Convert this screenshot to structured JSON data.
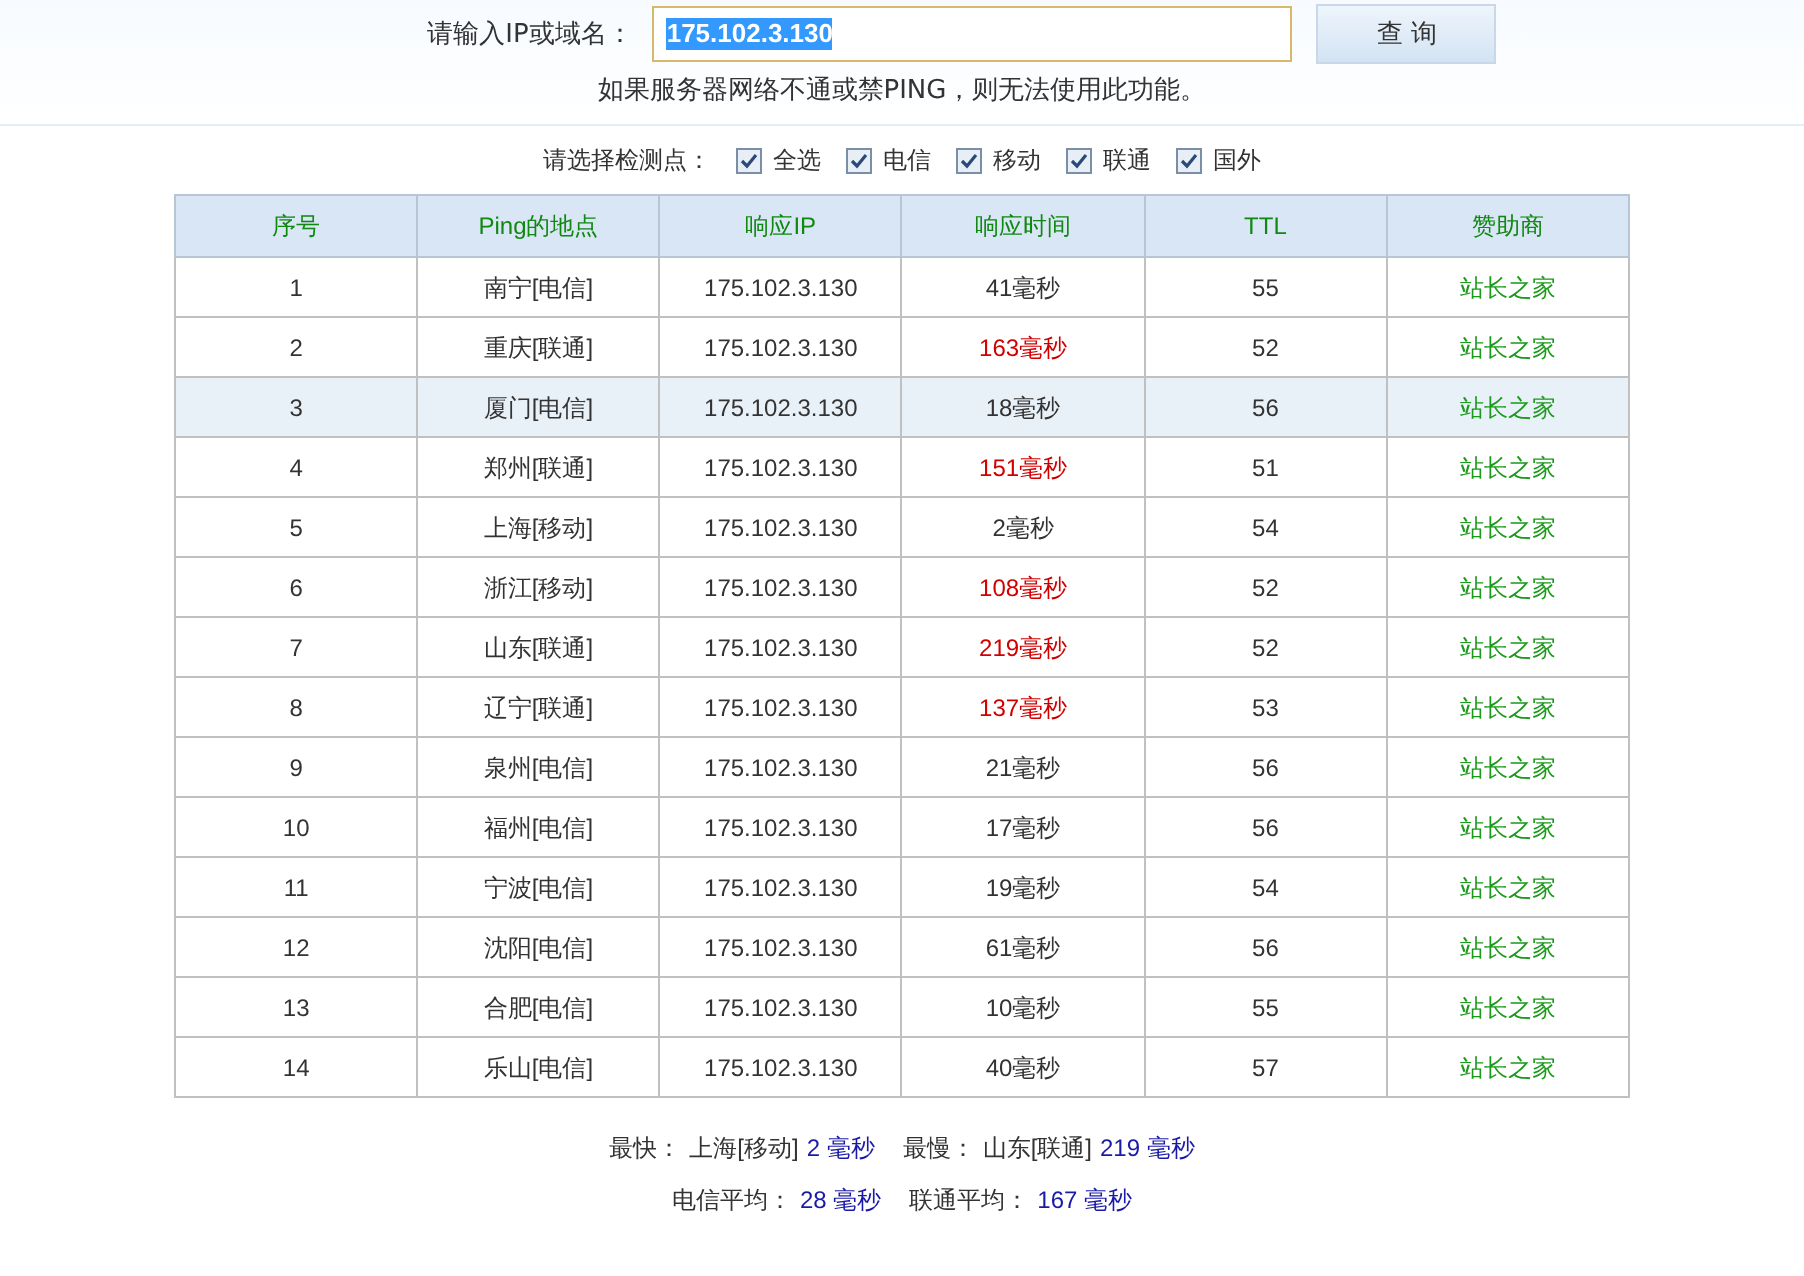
{
  "query": {
    "label": "请输入IP或域名：",
    "value": "175.102.3.130",
    "button": "查 询",
    "note": "如果服务器网络不通或禁PING，则无法使用此功能。"
  },
  "filters": {
    "label": "请选择检测点：",
    "options": [
      {
        "label": "全选",
        "checked": true
      },
      {
        "label": "电信",
        "checked": true
      },
      {
        "label": "移动",
        "checked": true
      },
      {
        "label": "联通",
        "checked": true
      },
      {
        "label": "国外",
        "checked": true
      }
    ]
  },
  "table": {
    "columns": [
      "序号",
      "Ping的地点",
      "响应IP",
      "响应时间",
      "TTL",
      "赞助商"
    ],
    "rows": [
      {
        "no": "1",
        "location": "南宁[电信]",
        "ip": "175.102.3.130",
        "time": "41毫秒",
        "slow": false,
        "ttl": "55",
        "sponsor": "站长之家",
        "selected": false
      },
      {
        "no": "2",
        "location": "重庆[联通]",
        "ip": "175.102.3.130",
        "time": "163毫秒",
        "slow": true,
        "ttl": "52",
        "sponsor": "站长之家",
        "selected": false
      },
      {
        "no": "3",
        "location": "厦门[电信]",
        "ip": "175.102.3.130",
        "time": "18毫秒",
        "slow": false,
        "ttl": "56",
        "sponsor": "站长之家",
        "selected": true
      },
      {
        "no": "4",
        "location": "郑州[联通]",
        "ip": "175.102.3.130",
        "time": "151毫秒",
        "slow": true,
        "ttl": "51",
        "sponsor": "站长之家",
        "selected": false
      },
      {
        "no": "5",
        "location": "上海[移动]",
        "ip": "175.102.3.130",
        "time": "2毫秒",
        "slow": false,
        "ttl": "54",
        "sponsor": "站长之家",
        "selected": false
      },
      {
        "no": "6",
        "location": "浙江[移动]",
        "ip": "175.102.3.130",
        "time": "108毫秒",
        "slow": true,
        "ttl": "52",
        "sponsor": "站长之家",
        "selected": false
      },
      {
        "no": "7",
        "location": "山东[联通]",
        "ip": "175.102.3.130",
        "time": "219毫秒",
        "slow": true,
        "ttl": "52",
        "sponsor": "站长之家",
        "selected": false
      },
      {
        "no": "8",
        "location": "辽宁[联通]",
        "ip": "175.102.3.130",
        "time": "137毫秒",
        "slow": true,
        "ttl": "53",
        "sponsor": "站长之家",
        "selected": false
      },
      {
        "no": "9",
        "location": "泉州[电信]",
        "ip": "175.102.3.130",
        "time": "21毫秒",
        "slow": false,
        "ttl": "56",
        "sponsor": "站长之家",
        "selected": false
      },
      {
        "no": "10",
        "location": "福州[电信]",
        "ip": "175.102.3.130",
        "time": "17毫秒",
        "slow": false,
        "ttl": "56",
        "sponsor": "站长之家",
        "selected": false
      },
      {
        "no": "11",
        "location": "宁波[电信]",
        "ip": "175.102.3.130",
        "time": "19毫秒",
        "slow": false,
        "ttl": "54",
        "sponsor": "站长之家",
        "selected": false
      },
      {
        "no": "12",
        "location": "沈阳[电信]",
        "ip": "175.102.3.130",
        "time": "61毫秒",
        "slow": false,
        "ttl": "56",
        "sponsor": "站长之家",
        "selected": false
      },
      {
        "no": "13",
        "location": "合肥[电信]",
        "ip": "175.102.3.130",
        "time": "10毫秒",
        "slow": false,
        "ttl": "55",
        "sponsor": "站长之家",
        "selected": false
      },
      {
        "no": "14",
        "location": "乐山[电信]",
        "ip": "175.102.3.130",
        "time": "40毫秒",
        "slow": false,
        "ttl": "57",
        "sponsor": "站长之家",
        "selected": false
      }
    ]
  },
  "summary": [
    [
      {
        "label": "最快：",
        "place": "上海[移动]",
        "value": "2 毫秒"
      },
      {
        "label": "最慢：",
        "place": "山东[联通]",
        "value": "219 毫秒"
      }
    ],
    [
      {
        "label": "电信平均：",
        "value": "28 毫秒"
      },
      {
        "label": "联通平均：",
        "value": "167 毫秒"
      }
    ]
  ]
}
